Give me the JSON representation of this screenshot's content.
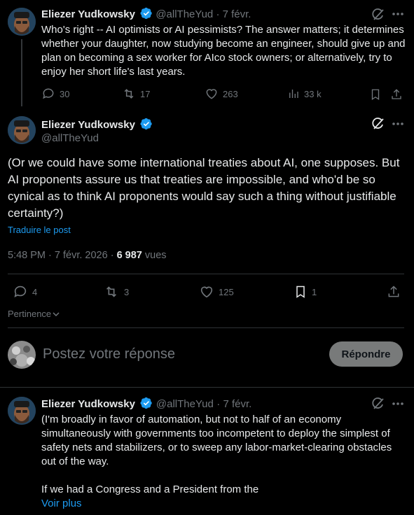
{
  "tweet1": {
    "name": "Eliezer Yudkowsky",
    "handle": "@allTheYud",
    "date": "· 7 févr.",
    "text": "Who's right -- AI optimists or AI pessimists?  The answer matters; it determines whether your daughter, now studying become an engineer, should give up and plan on becoming a sex worker for AIco stock owners; or alternatively, try to enjoy her short life's last years.",
    "replies": "30",
    "reposts": "17",
    "likes": "263",
    "views": "33 k"
  },
  "main": {
    "name": "Eliezer Yudkowsky",
    "handle": "@allTheYud",
    "text": "(Or we could have some international treaties about AI, one supposes. But AI proponents assure us that treaties are impossible, and who'd be so cynical as to think AI proponents would say such a thing without justifiable certainty?)",
    "translate": "Traduire le post",
    "timestamp": "5:48 PM · 7 févr. 2026 · ",
    "views_count": "6 987",
    "views_label": " vues",
    "replies": "4",
    "reposts": "3",
    "likes": "125",
    "bookmarks": "1"
  },
  "sort": {
    "label": "Pertinence"
  },
  "composer": {
    "placeholder": "Postez votre réponse",
    "button": "Répondre"
  },
  "tweet3": {
    "name": "Eliezer Yudkowsky",
    "handle": "@allTheYud",
    "date": "· 7 févr.",
    "text1": "(I'm broadly in favor of automation, but not to half of an economy simultaneously with governments too incompetent to deploy the simplest of safety nets and stabilizers, or to sweep any labor-market-clearing obstacles out of the way.",
    "text2": "If we had a Congress and a President from the",
    "more": "Voir plus"
  },
  "colors": {
    "accent": "#1d9bf0",
    "background": "#000000",
    "muted": "#71767b"
  },
  "icons": [
    "grok-icon",
    "more-icon",
    "reply-icon",
    "repost-icon",
    "like-icon",
    "views-icon",
    "bookmark-icon",
    "share-icon",
    "verified-icon"
  ]
}
